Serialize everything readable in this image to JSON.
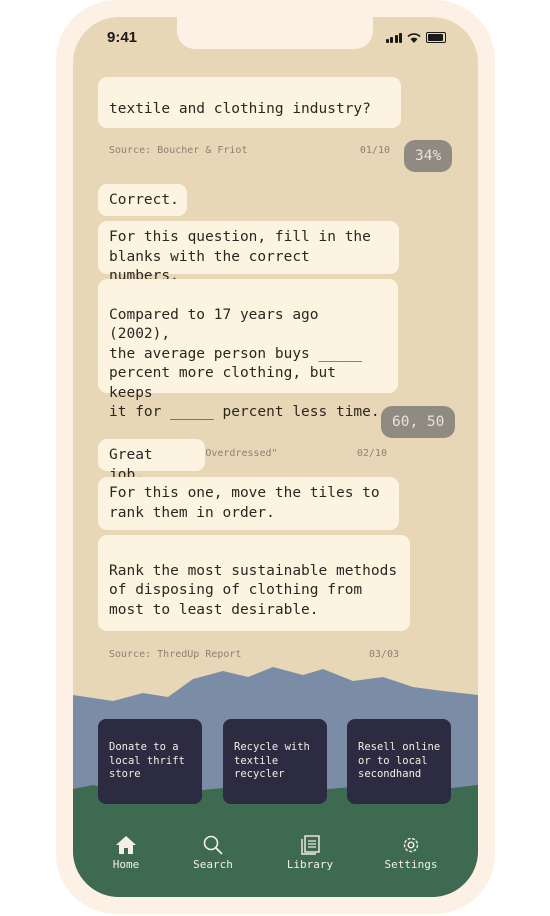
{
  "status": {
    "time": "9:41"
  },
  "messages": {
    "q1_text_tail": "textile and clothing industry?",
    "q1_source": "Source: Boucher & Friot",
    "q1_counter": "01/10",
    "answer1": "34%",
    "feedback1": "Correct.",
    "instruction2": "For this question, fill in the\nblanks with the correct numbers.",
    "q2_text": "Compared to 17 years ago (2002),\nthe average person buys _____\npercent more clothing, but keeps\nit for _____ percent less time.",
    "q2_source": "Source: Cline, \"Overdressed\"",
    "q2_counter": "02/10",
    "answer2": "60, 50",
    "feedback2": "Great job.",
    "instruction3": "For this one, move the tiles to\nrank them in order.",
    "q3_text": "Rank the most sustainable methods\nof disposing of clothing from\nmost to least desirable.",
    "q3_source": "Source: ThredUp Report",
    "q3_counter": "03/03"
  },
  "tiles": [
    "Donate to a\nlocal thrift\nstore",
    "Recycle with\ntextile\nrecycler",
    "Resell online\nor to local\nsecondhand"
  ],
  "nav": [
    {
      "label": "Home",
      "icon": "home-icon",
      "active": true
    },
    {
      "label": "Search",
      "icon": "search-icon"
    },
    {
      "label": "Library",
      "icon": "library-icon"
    },
    {
      "label": "Settings",
      "icon": "gear-icon"
    }
  ],
  "colors": {
    "background": "#e8d7b7",
    "bubble": "#fdf3e1",
    "answer_bubble": "#8f8a82",
    "tile": "#2c2b41",
    "sky_mountain": "#7b8da6",
    "grass": "#3e6a52"
  }
}
